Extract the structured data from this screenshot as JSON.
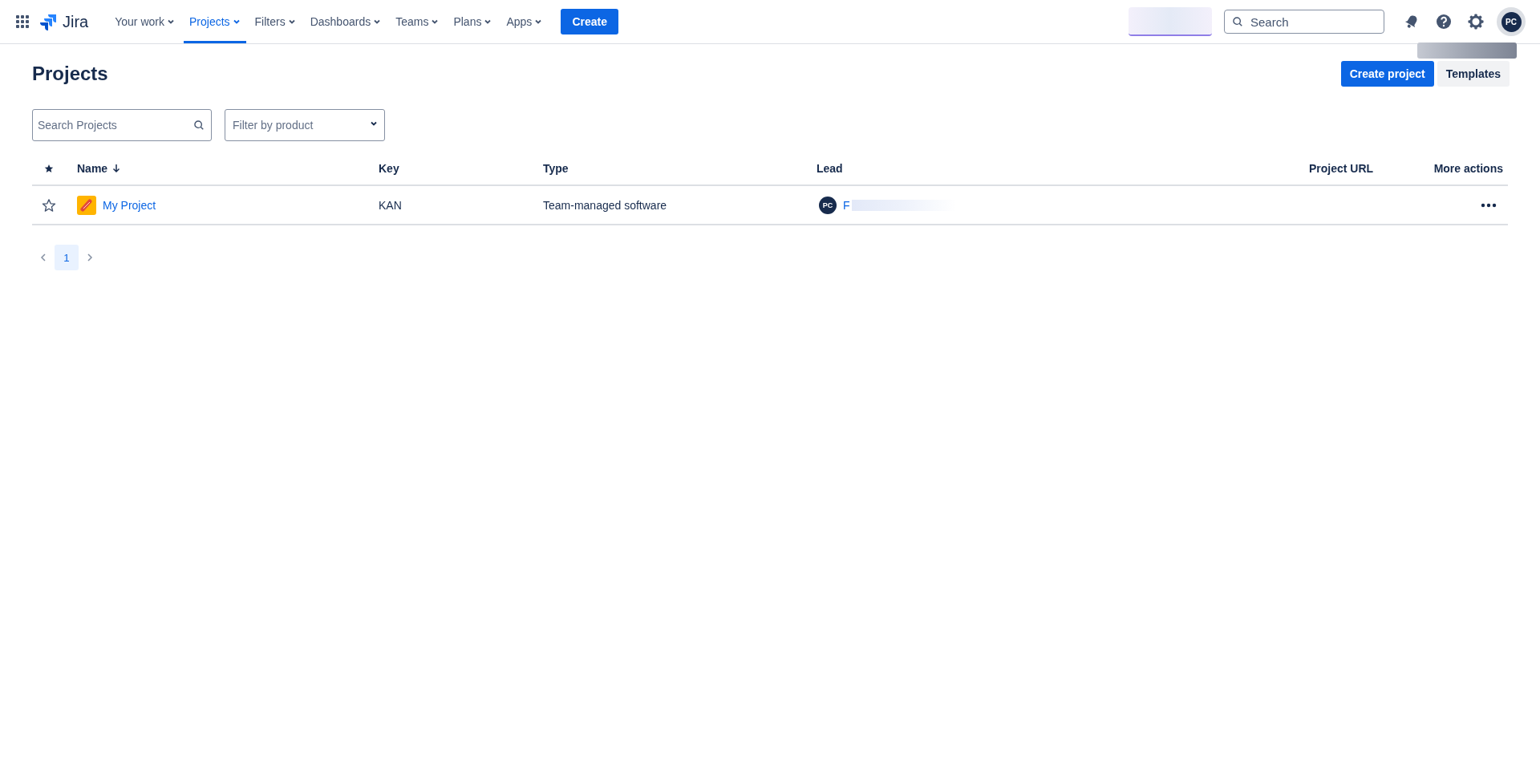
{
  "header": {
    "logo": "Jira",
    "nav": [
      {
        "label": "Your work",
        "selected": false
      },
      {
        "label": "Projects",
        "selected": true
      },
      {
        "label": "Filters",
        "selected": false
      },
      {
        "label": "Dashboards",
        "selected": false
      },
      {
        "label": "Teams",
        "selected": false
      },
      {
        "label": "Plans",
        "selected": false
      },
      {
        "label": "Apps",
        "selected": false
      }
    ],
    "create_button": "Create",
    "search": {
      "placeholder": "Search"
    },
    "avatar": "PC"
  },
  "page": {
    "title": "Projects",
    "buttons": [
      "Create project",
      "Templates"
    ],
    "search": {
      "placeholder": "Search Projects"
    },
    "filter": {
      "placeholder": "Filter by product"
    }
  },
  "table": {
    "columns": [
      "Name",
      "Key",
      "Type",
      "Lead",
      "Project URL",
      "More actions"
    ],
    "rows": [
      {
        "starred": false,
        "name": "My Project",
        "key": "KAN",
        "type": "Team-managed software",
        "lead_avatar": "PC",
        "lead": "F"
      }
    ]
  },
  "pagination": {
    "pages": [
      {
        "label": "1",
        "selected": true
      }
    ]
  }
}
